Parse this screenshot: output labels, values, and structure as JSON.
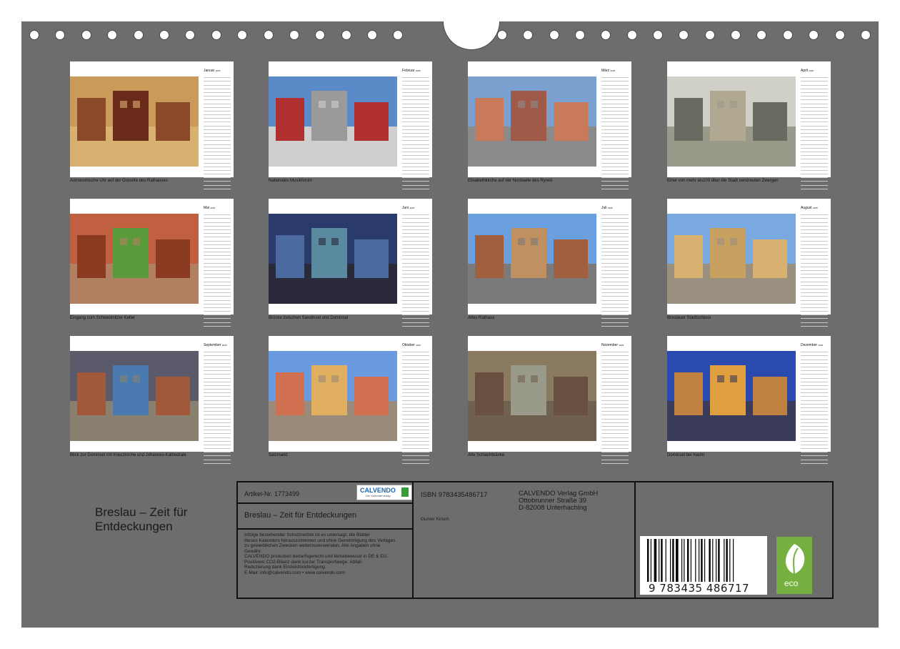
{
  "months": [
    {
      "name": "Januar",
      "year": "2025",
      "caption": "Astronomische Uhr auf der Ostseite des Rathauses",
      "icon": "clock-photo"
    },
    {
      "name": "Februar",
      "year": "2025",
      "caption": "Nationales Musikforum",
      "icon": "building-photo"
    },
    {
      "name": "März",
      "year": "2025",
      "caption": "Elisabethkirche auf der Nordseite des Rynek",
      "icon": "market-square-photo"
    },
    {
      "name": "April",
      "year": "2025",
      "caption": "Einer von mehr als100 über die Stadt verstreuten Zwergen",
      "icon": "dwarf-statue-photo"
    },
    {
      "name": "Mai",
      "year": "2025",
      "caption": "Eingang zum Schweidnitzer Keller",
      "icon": "doorway-photo"
    },
    {
      "name": "Juni",
      "year": "2025",
      "caption": "Brücke zwischen Sandinsel und Dominsel",
      "icon": "bridge-photo"
    },
    {
      "name": "Juli",
      "year": "2025",
      "caption": "Altes Rathaus",
      "icon": "town-hall-photo"
    },
    {
      "name": "August",
      "year": "2025",
      "caption": "Breslauer Stadtschloss",
      "icon": "palace-photo"
    },
    {
      "name": "September",
      "year": "2025",
      "caption": "Blick zur Dominsel mit Kreuzkirche und Johannes-Kathedrale",
      "icon": "cathedral-river-photo"
    },
    {
      "name": "Oktober",
      "year": "2025",
      "caption": "Salzmarkt",
      "icon": "colorful-houses-photo"
    },
    {
      "name": "November",
      "year": "2025",
      "caption": "Alte Schlachtbänke",
      "icon": "pig-statues-photo"
    },
    {
      "name": "Dezember",
      "year": "2025",
      "caption": "Dominsel bei Nacht",
      "icon": "night-cathedral-photo"
    }
  ],
  "back": {
    "title_line1": "Breslau – Zeit für",
    "title_line2": "Entdeckungen",
    "article": "Artikel-Nr. 1773499",
    "logo_brand": "CALVENDO",
    "logo_sub": "Der Kalenderverlag",
    "subtitle": "Breslau – Zeit für Entdeckungen",
    "legal": [
      "Infolge bestehender Schutzrechte ist es untersagt, die Blätter",
      "dieses Kalenders herauszutrennen und ohne Genehmigung des Verlages",
      "zu gewerblichen Zwecken weiterzuverwenden. Alle Angaben ohne",
      "Gewähr.",
      "CALVENDO produziert bedarfsgerecht und klimabewusst in DE & EU.",
      "Positivere CO2-Bilanz dank kurzer Transportwege. Abfall-",
      "Reduzierung dank Einzelstückfertigung.",
      "E-Mail: info@calvendo.com • www.calvendo.com"
    ],
    "isbn": "ISBN 9783435486717",
    "author": "Gunter Kirsch",
    "publisher": [
      "CALVENDO Verlag GmbH",
      "Ottobrunner Straße 39",
      "D-82008 Unterhaching"
    ],
    "barcode_text": "9 783435 486717",
    "eco_label": "eco"
  },
  "colors": {
    "cover": "#6d6d6d",
    "frame": "#111111",
    "eco": "#76b041",
    "brand": "#1a67b0"
  }
}
